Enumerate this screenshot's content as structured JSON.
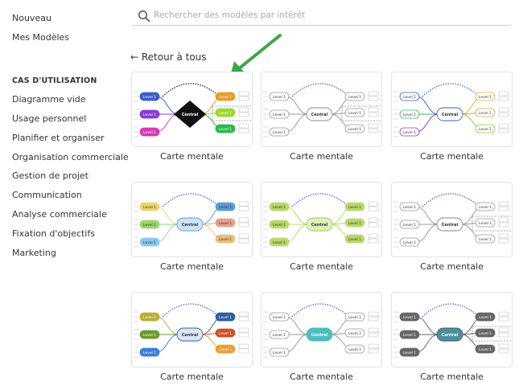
{
  "sidebar": {
    "top_items": [
      {
        "label": "Nouveau"
      },
      {
        "label": "Mes Modèles"
      }
    ],
    "section_title": "CAS D'UTILISATION",
    "items": [
      {
        "label": "Diagramme vide"
      },
      {
        "label": "Usage personnel"
      },
      {
        "label": "Planifier et organiser"
      },
      {
        "label": "Organisation commerciale"
      },
      {
        "label": "Gestion de projet"
      },
      {
        "label": "Communication"
      },
      {
        "label": "Analyse commerciale"
      },
      {
        "label": "Fixation d'objectifs"
      },
      {
        "label": "Marketing"
      }
    ]
  },
  "search": {
    "placeholder": "Rechercher des modèles par intérêt",
    "value": ""
  },
  "back_link": "← Retour à tous",
  "templates": [
    {
      "caption": "Carte mentale",
      "central": "Central",
      "level": "Level 1",
      "accent": "#000000"
    },
    {
      "caption": "Carte mentale",
      "central": "Central",
      "level": "Level 1",
      "accent": "#888888"
    },
    {
      "caption": "Carte mentale",
      "central": "Central",
      "level": "Level 1",
      "accent": "#3a5fc8"
    },
    {
      "caption": "Carte mentale",
      "central": "Central",
      "level": "Level 1",
      "accent": "#5b9bd5"
    },
    {
      "caption": "Carte mentale",
      "central": "Central",
      "level": "Level 1",
      "accent": "#9ccc3c"
    },
    {
      "caption": "Carte mentale",
      "central": "Central",
      "level": "Level 1",
      "accent": "#888888"
    },
    {
      "caption": "Carte mentale",
      "central": "Central",
      "level": "Level 1",
      "accent": "#2f5f9f"
    },
    {
      "caption": "Carte mentale",
      "central": "Central",
      "level": "Level 1",
      "accent": "#4dbdbd"
    },
    {
      "caption": "Carte mentale",
      "central": "Central",
      "level": "Level 1",
      "accent": "#555555"
    }
  ],
  "colors": {
    "annotation_arrow": "#3da64a",
    "text": "#333333",
    "placeholder": "#aaaaaa"
  }
}
